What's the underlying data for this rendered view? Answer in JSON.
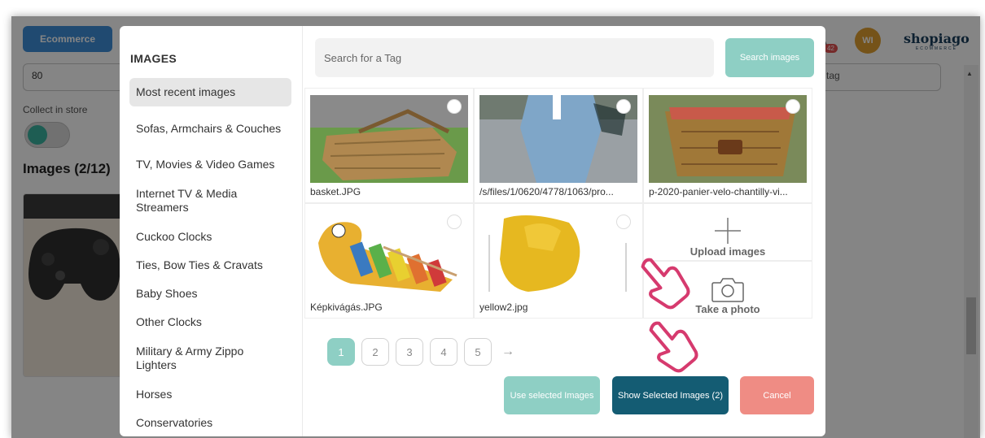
{
  "background": {
    "ecommerce_button": "Ecommerce",
    "quantity_value": "80",
    "collect_label": "Collect in store",
    "images_heading": "Images (2/12)",
    "tag_value": "tag",
    "avatar_initials": "WI",
    "notification_count": "42",
    "logo_name": "shopiago",
    "logo_sub": "ECOMMERCE"
  },
  "modal": {
    "title": "IMAGES",
    "categories": [
      {
        "label": "Most recent images",
        "active": true
      },
      {
        "label": "Sofas, Armchairs & Couches"
      },
      {
        "label": "TV, Movies & Video Games"
      },
      {
        "label": "Internet TV & Media Streamers"
      },
      {
        "label": "Cuckoo Clocks"
      },
      {
        "label": "Ties, Bow Ties & Cravats"
      },
      {
        "label": "Baby Shoes"
      },
      {
        "label": "Other Clocks"
      },
      {
        "label": "Military & Army Zippo Lighters"
      },
      {
        "label": "Horses"
      },
      {
        "label": "Conservatories"
      }
    ],
    "search": {
      "placeholder": "Search for a Tag",
      "button": "Search images"
    },
    "images": [
      {
        "filename": "basket.JPG"
      },
      {
        "filename": "/s/files/1/0620/4778/1063/pro..."
      },
      {
        "filename": "p-2020-panier-velo-chantilly-vi..."
      },
      {
        "filename": "Képkivágás.JPG"
      },
      {
        "filename": "yellow2.jpg"
      }
    ],
    "upload_label": "Upload images",
    "photo_label": "Take a photo",
    "pagination": {
      "pages": [
        "1",
        "2",
        "3",
        "4",
        "5"
      ],
      "current": "1",
      "next": "→"
    },
    "buttons": {
      "use_selected": "Use selected Images",
      "show_selected": "Show Selected Images (2)",
      "cancel": "Cancel"
    }
  },
  "colors": {
    "accent_teal": "#8ecfc4",
    "dark_teal": "#145c73",
    "cancel_red": "#ef8c84",
    "cursor_pink": "#d63a6e"
  }
}
